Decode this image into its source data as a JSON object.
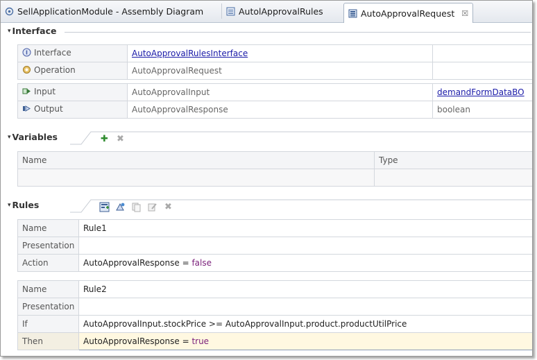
{
  "tabs": [
    {
      "label": "SellApplicationModule - Assembly Diagram",
      "icon": "assembly-diagram-icon"
    },
    {
      "label": "AutolApprovalRules",
      "icon": "rule-group-icon"
    },
    {
      "label": "AutoApprovalRequest",
      "icon": "ruleset-icon",
      "close": "☒"
    }
  ],
  "interface": {
    "title": "Interface",
    "rows": [
      {
        "label": "Interface",
        "icon": "interface-icon",
        "value": "AutoApprovalRulesInterface",
        "extra": ""
      },
      {
        "label": "Operation",
        "icon": "operation-icon",
        "value": "AutoApprovalRequest",
        "extra": ""
      },
      {
        "label": "Input",
        "icon": "input-icon",
        "value": "AutoApprovalInput",
        "extra": "demandFormDataBO"
      },
      {
        "label": "Output",
        "icon": "output-icon",
        "value": "AutoApprovalResponse",
        "extra": "boolean"
      }
    ]
  },
  "variables": {
    "title": "Variables",
    "columns": [
      "Name",
      "Type"
    ]
  },
  "rules": {
    "title": "Rules",
    "rule1": {
      "name_label": "Name",
      "name": "Rule1",
      "presentation_label": "Presentation",
      "presentation": "",
      "action_label": "Action",
      "action_target": "AutoApprovalResponse",
      "action_op": " = ",
      "action_value": "false"
    },
    "rule2": {
      "name_label": "Name",
      "name": "Rule2",
      "presentation_label": "Presentation",
      "presentation": "",
      "if_label": "If",
      "if_expr": "AutoApprovalInput.stockPrice >= AutoApprovalInput.product.productUtilPrice",
      "then_label": "Then",
      "then_target": "AutoApprovalResponse",
      "then_op": " = ",
      "then_value": "true"
    }
  },
  "colors": {
    "link": "#1a1aa8",
    "keyword": "#7a1f7a",
    "highlight_row": "#fff8e1"
  }
}
